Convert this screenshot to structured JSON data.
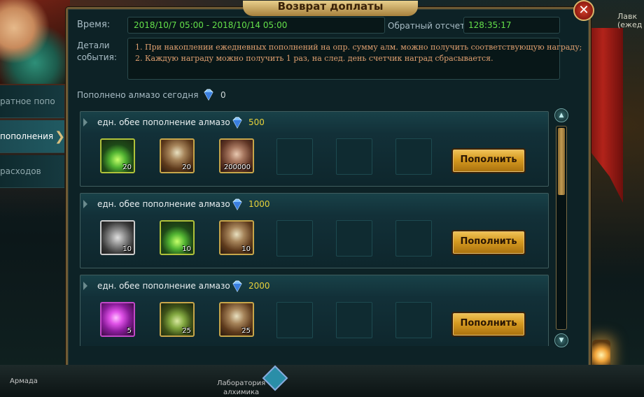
{
  "window": {
    "title": "Возврат доплаты",
    "close_glyph": "✕"
  },
  "info": {
    "time_label": "Время:",
    "time_value": "2018/10/7 05:00 - 2018/10/14 05:00",
    "countdown_label": "Обратный отсчет:",
    "countdown_value": "128:35:17",
    "details_label_1": "Детали",
    "details_label_2": "события:",
    "details_line_1": "1. При накоплении ежедневных пополнений на опр. сумму алм. можно получить соответствующую награду;",
    "details_line_2": "2. Каждую награду можно получить 1 раз, на след. день счетчик наград сбрасывается."
  },
  "topped_up": {
    "label": "Пополнено алмазо сегодня",
    "value": "0"
  },
  "sidebar": {
    "items": [
      {
        "label": "ратное попо"
      },
      {
        "label": "пополнения"
      },
      {
        "label": "расходов"
      }
    ]
  },
  "rewards": [
    {
      "title": "едн. обее пополнение алмазо",
      "amount": "500",
      "button": "Пополнить",
      "items": [
        {
          "icon": "potion-icon",
          "count": "20"
        },
        {
          "icon": "loot-bag-icon",
          "count": "20"
        },
        {
          "icon": "wood-bundle-icon",
          "count": "200000"
        }
      ]
    },
    {
      "title": "едн. обее пополнение алмазо",
      "amount": "1000",
      "button": "Пополнить",
      "items": [
        {
          "icon": "tome-icon",
          "count": "10"
        },
        {
          "icon": "potion-icon",
          "count": "10"
        },
        {
          "icon": "loot-bag-icon",
          "count": "10"
        }
      ]
    },
    {
      "title": "едн. обее пополнение алмазо",
      "amount": "2000",
      "button": "Пополнить",
      "items": [
        {
          "icon": "magic-orb-icon",
          "count": "5"
        },
        {
          "icon": "potion-jar-icon",
          "count": "25"
        },
        {
          "icon": "loot-bag-icon",
          "count": "25"
        }
      ]
    }
  ],
  "scroll": {
    "up_glyph": "▲",
    "down_glyph": "▼"
  },
  "bottom": {
    "armada": "Армада",
    "lab": "Лаборатория",
    "lab2": "алхимика"
  },
  "corner": {
    "shop_1": "Лавк",
    "shop_2": "(ежед"
  },
  "colors": {
    "accent_gold": "#d69a20",
    "value_green": "#64e04a",
    "amount_yellow": "#e8d23a"
  }
}
